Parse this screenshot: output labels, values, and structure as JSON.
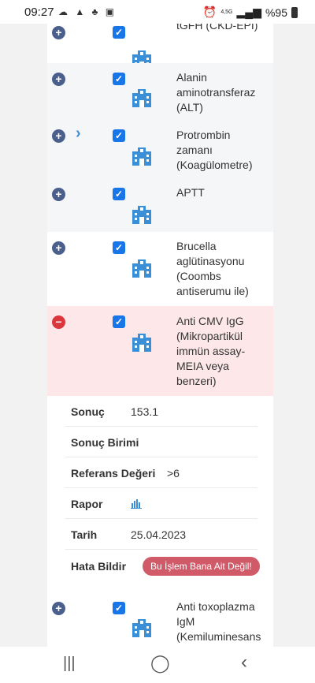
{
  "status_bar": {
    "time": "09:27",
    "network_label": "4,5G",
    "battery": "%95"
  },
  "tests": [
    {
      "name": "tGFH (CKD-EPI)",
      "expanded": false,
      "checked": true
    },
    {
      "name": "Alanin aminotransferaz (ALT)",
      "expanded": false,
      "checked": true
    },
    {
      "name": "Protrombin zamanı (Koagülometre)",
      "expanded": false,
      "checked": true
    },
    {
      "name": "APTT",
      "expanded": false,
      "checked": true
    },
    {
      "name": "Brucella aglütinasyonu (Coombs antiserumu ile)",
      "expanded": false,
      "checked": true
    },
    {
      "name": "Anti CMV IgG (Mikropartikül immün assay-MEIA veya benzeri)",
      "expanded": true,
      "checked": true
    },
    {
      "name": "Anti toxoplazma IgM (Kemiluminesans",
      "expanded": false,
      "checked": true
    }
  ],
  "detail": {
    "result_label": "Sonuç",
    "result_value": "153.1",
    "unit_label": "Sonuç Birimi",
    "unit_value": "",
    "reference_label": "Referans Değeri",
    "reference_value": ">6",
    "report_label": "Rapor",
    "date_label": "Tarih",
    "date_value": "25.04.2023",
    "error_label": "Hata Bildir",
    "error_button": "Bu İşlem Bana Ait Değil!"
  },
  "icons": {
    "expand": "plus-circle-icon",
    "collapse": "minus-circle-icon",
    "checkbox": "checkbox-checked-icon",
    "hospital": "hospital-building-icon",
    "report": "bar-chart-icon",
    "chevron": "chevron-right-icon"
  },
  "colors": {
    "expander_plus": "#4a5f8c",
    "expander_minus": "#d9363e",
    "checkbox": "#1976e8",
    "hospital_icon": "#3b8fd6",
    "active_row_bg": "#fde7e9",
    "error_button_bg": "#d05a68"
  }
}
